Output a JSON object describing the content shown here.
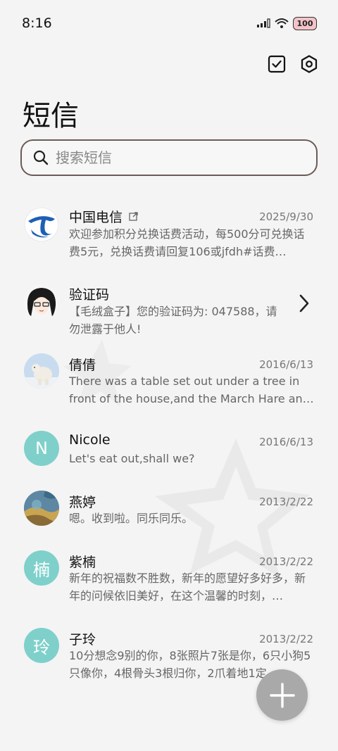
{
  "status_bar": {
    "time": "8:16",
    "battery": "100"
  },
  "header": {
    "title": "短信",
    "actions": [
      {
        "icon": "checkbox-icon"
      },
      {
        "icon": "settings-hex-icon"
      }
    ]
  },
  "search": {
    "placeholder": "搜索短信"
  },
  "conversations": [
    {
      "name": "中国电信",
      "date": "2025/9/30",
      "preview": "欢迎参加积分兑换话费活动，每500分可兑换话费5元，兑换话费请回复106或jfdh#话费…",
      "avatar": "china-telecom-logo"
    },
    {
      "name": "验证码",
      "preview": "【毛绒盒子】您的验证码为: 047588，请勿泄露于他人!",
      "avatar": "anime-girl-avatar"
    },
    {
      "name": "倩倩",
      "date": "2016/6/13",
      "preview": "There was a table set out under a tree in front of the house,and the March Hare an…",
      "avatar": "polar-bear-photo"
    },
    {
      "name": "Nicole",
      "date": "2016/6/13",
      "preview": "Let's eat out,shall we?",
      "avatar_letter": "N"
    },
    {
      "name": "燕婷",
      "date": "2013/2/22",
      "preview": "嗯。收到啦。同乐同乐。",
      "avatar": "abstract-painting-photo"
    },
    {
      "name": "紫楠",
      "date": "2013/2/22",
      "preview": "新年的祝福数不胜数，新年的愿望好多好多，新年的问候依旧美好，在这个温馨的时刻，…",
      "avatar_letter": "楠"
    },
    {
      "name": "子玲",
      "date": "2013/2/22",
      "preview": "10分想念9别的你，8张照片7张是你，6只小狗5只像你，4根骨头3根归你，2爪着地1定…",
      "avatar_letter": "玲"
    }
  ],
  "colors": {
    "letter_avatar": "#7fd0cb",
    "fab": "#a9a9a9",
    "search_border": "#6b5b56",
    "background": "#f4f4f4"
  }
}
